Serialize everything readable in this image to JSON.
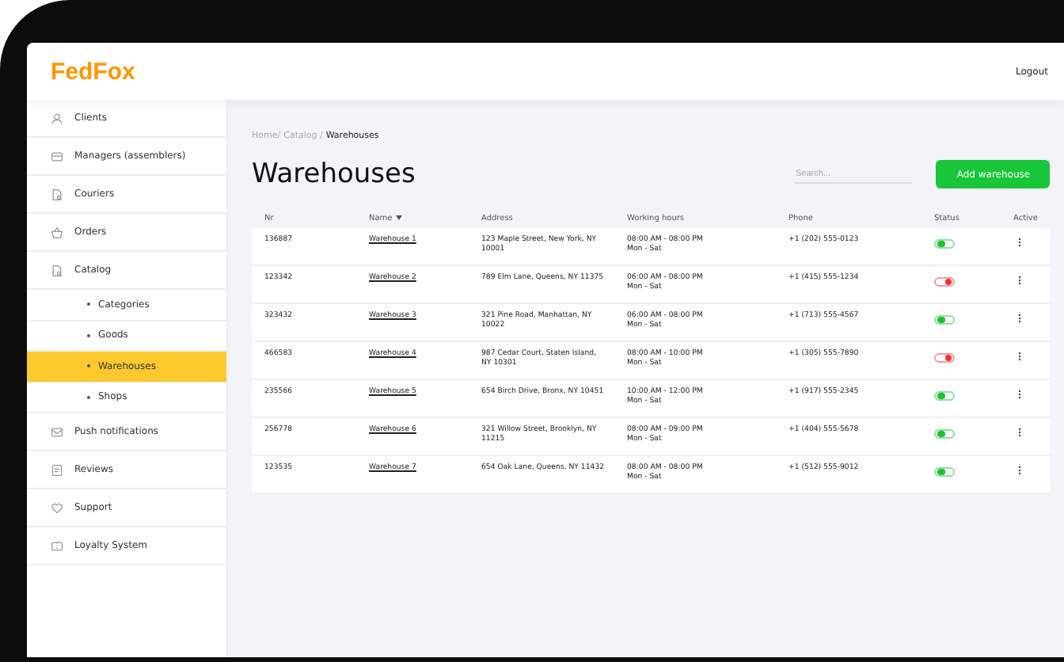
{
  "header": {
    "logo": "FedFox",
    "logout": "Logout"
  },
  "sidebar": {
    "items": [
      {
        "label": "Clients",
        "selected": false
      },
      {
        "label": "Managers (assemblers)",
        "selected": false
      },
      {
        "label": "Couriers",
        "selected": false
      },
      {
        "label": "Orders",
        "selected": false
      },
      {
        "label": "Catalog",
        "selected": false,
        "children": [
          {
            "label": "Categories",
            "selected": false
          },
          {
            "label": "Goods",
            "selected": false
          },
          {
            "label": "Warehouses",
            "selected": true
          },
          {
            "label": "Shops",
            "selected": false
          }
        ]
      },
      {
        "label": "Push notifications",
        "selected": false
      },
      {
        "label": "Reviews",
        "selected": false
      },
      {
        "label": "Support",
        "selected": false
      },
      {
        "label": "Loyalty System",
        "selected": false
      }
    ]
  },
  "breadcrumb": [
    "Home/",
    "Catalog /",
    "Warehouses"
  ],
  "title": "Warehouses",
  "search": {
    "placeholder": "Search..."
  },
  "add_button": "Add warehouse",
  "table": {
    "columns": [
      {
        "label": "Nr",
        "sorted": false
      },
      {
        "label": "Name",
        "sorted": true
      },
      {
        "label": "Address",
        "sorted": false
      },
      {
        "label": "Working hours",
        "sorted": false
      },
      {
        "label": "Phone",
        "sorted": false
      },
      {
        "label": "Status",
        "sorted": false
      },
      {
        "label": "Active",
        "sorted": false
      }
    ],
    "rows": [
      {
        "nr": "136887",
        "name": "Warehouse 1",
        "address": "123 Maple Street, New York, NY 10001",
        "hours": "08:00 AM - 08:00 PM",
        "days": "Mon - Sat",
        "phone": "+1 (202) 555-0123",
        "on": true
      },
      {
        "nr": "123342",
        "name": "Warehouse 2",
        "address": "789 Elm Lane, Queens, NY 11375",
        "hours": "06:00 AM - 08:00 PM",
        "days": "Mon - Sat",
        "phone": "+1 (415) 555-1234",
        "on": false
      },
      {
        "nr": "323432",
        "name": "Warehouse 3",
        "address": "321 Pine Road, Manhattan, NY 10022",
        "hours": "06:00 AM - 08:00 PM",
        "days": "Mon - Sat",
        "phone": "+1 (713) 555-4567",
        "on": true
      },
      {
        "nr": "466583",
        "name": "Warehouse 4",
        "address": "987 Cedar Court, Staten Island, NY 10301",
        "hours": "08:00 AM - 10:00 PM",
        "days": "Mon - Sat",
        "phone": "+1 (305) 555-7890",
        "on": false
      },
      {
        "nr": "235566",
        "name": "Warehouse 5",
        "address": "654 Birch Drive, Bronx, NY 10451",
        "hours": "10:00 AM - 12:00 PM",
        "days": "Mon - Sat",
        "phone": "+1 (917) 555-2345",
        "on": true
      },
      {
        "nr": "256778",
        "name": "Warehouse 6",
        "address": "321 Willow Street, Brooklyn, NY 11215",
        "hours": "08:00 AM - 09:00 PM",
        "days": "Mon - Sat",
        "phone": "+1 (404) 555-5678",
        "on": true
      },
      {
        "nr": "123535",
        "name": "Warehouse 7",
        "address": "654 Oak Lane, Queens, NY 11432",
        "hours": "08:00 AM - 08:00 PM",
        "days": "Mon - Sat",
        "phone": "+1 (512) 555-9012",
        "on": true
      }
    ]
  }
}
